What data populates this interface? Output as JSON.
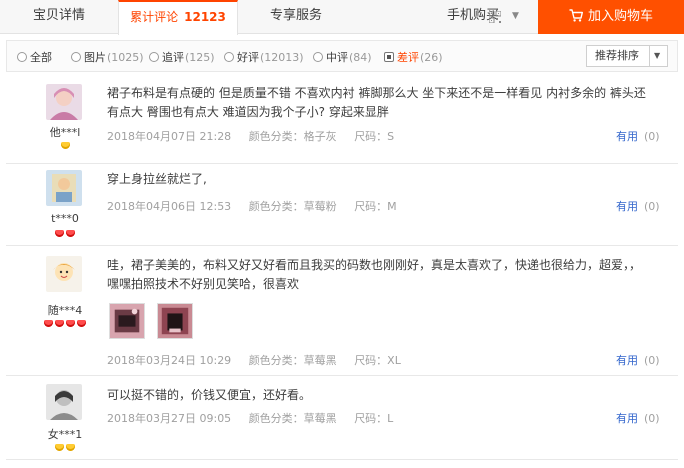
{
  "tabs": {
    "detail": "宝贝详情",
    "reviews": "累计评论",
    "reviews_count": "12123",
    "service": "专享服务",
    "mobile": "手机购买",
    "cart": "加入购物车"
  },
  "filters": [
    {
      "label": "全部",
      "count": ""
    },
    {
      "label": "图片",
      "count": "(1025)"
    },
    {
      "label": "追评",
      "count": "(125)"
    },
    {
      "label": "好评",
      "count": "(12013)"
    },
    {
      "label": "中评",
      "count": "(84)"
    },
    {
      "label": "差评",
      "count": "(26)"
    }
  ],
  "sort_label": "推荐排序",
  "reviews": [
    {
      "user": "他***l",
      "text": "裙子布料是有点硬的 但是质量不错 不喜欢内衬 裤脚那么大 坐下来还不是一样看见 内衬多余的 裤头还有点大 臀围也有点大 难道因为我个子小? 穿起来显胖",
      "date": "2018年04月07日 21:28",
      "color": "颜色分类：格子灰",
      "size": "尺码：S",
      "useful": "有用",
      "useful_count": "(0)"
    },
    {
      "user": "t***0",
      "text": "穿上身拉丝就烂了,",
      "date": "2018年04月06日 12:53",
      "color": "颜色分类：草莓粉",
      "size": "尺码：M",
      "useful": "有用",
      "useful_count": "(0)"
    },
    {
      "user": "随***4",
      "text": "哇，裙子美美的，布料又好又好看而且我买的码数也刚刚好，真是太喜欢了，快递也很给力，超爱，，嘿嘿拍照技术不好别见笑哈，很喜欢",
      "date": "2018年03月24日 10:29",
      "color": "颜色分类：草莓黑",
      "size": "尺码：XL",
      "useful": "有用",
      "useful_count": "(0)"
    },
    {
      "user": "女***1",
      "text": "可以挺不错的，价钱又便宜，还好看。",
      "date": "2018年03月27日 09:05",
      "color": "颜色分类：草莓黑",
      "size": "尺码：L",
      "useful": "有用",
      "useful_count": "(0)"
    }
  ]
}
